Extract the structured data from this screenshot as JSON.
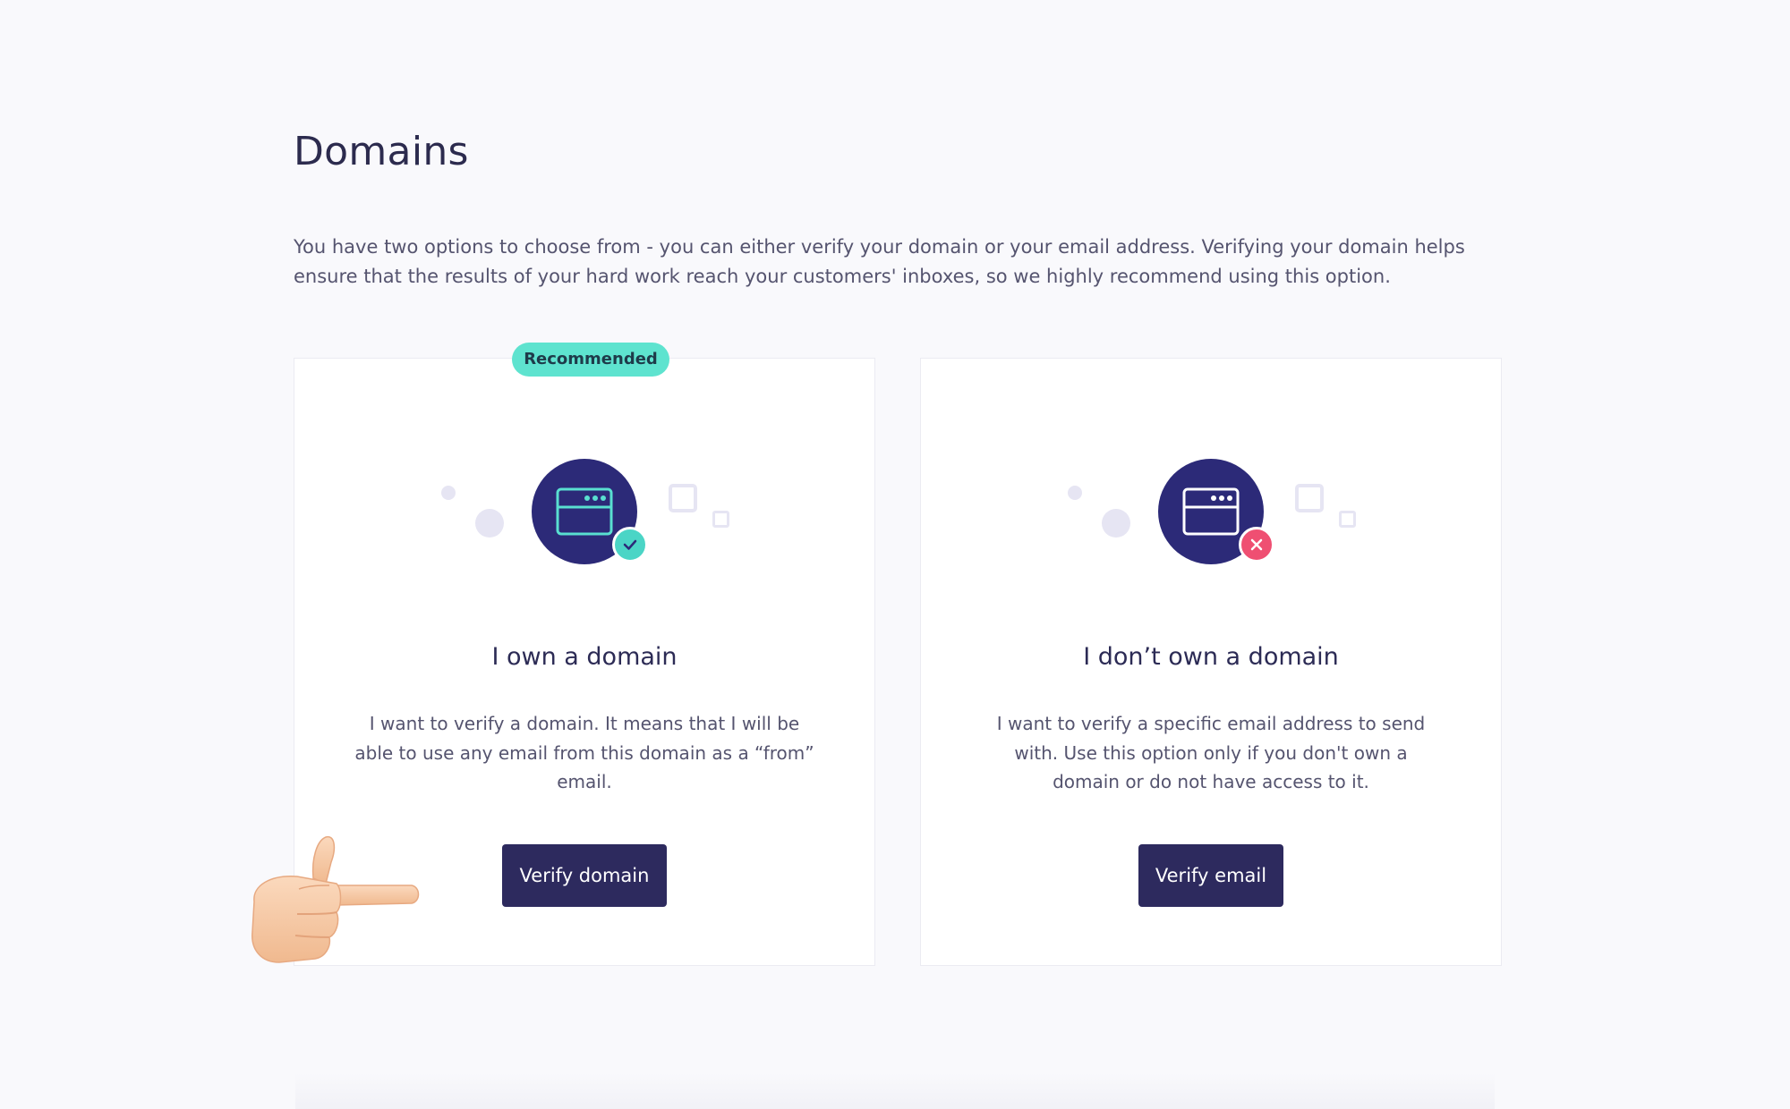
{
  "page": {
    "title": "Domains",
    "intro": "You have two options to choose from - you can either verify your domain or your email address. Verifying your domain helps ensure that the results of your hard work reach your customers' inboxes, so we highly recommend using this option."
  },
  "cards": [
    {
      "badge": "Recommended",
      "icon": "browser-window-icon",
      "status_icon": "check-icon",
      "title": "I own a domain",
      "description": "I want to verify a domain. It means that I will be able to use any email from this domain as a “from” email.",
      "button_label": "Verify domain"
    },
    {
      "icon": "browser-window-icon",
      "status_icon": "close-icon",
      "title": "I don’t own a domain",
      "description": "I want to verify a specific email address to send with. Use this option only if you don't own a domain or do not have access to it.",
      "button_label": "Verify email"
    }
  ],
  "colors": {
    "background": "#f9f9fc",
    "primary_button": "#2d2a5e",
    "illustration_circle": "#2c2a78",
    "badge": "#5ee3cf",
    "success": "#4bd5c6",
    "error": "#ef4f72"
  },
  "overlay": {
    "pointer_icon": "pointing-hand-icon"
  }
}
